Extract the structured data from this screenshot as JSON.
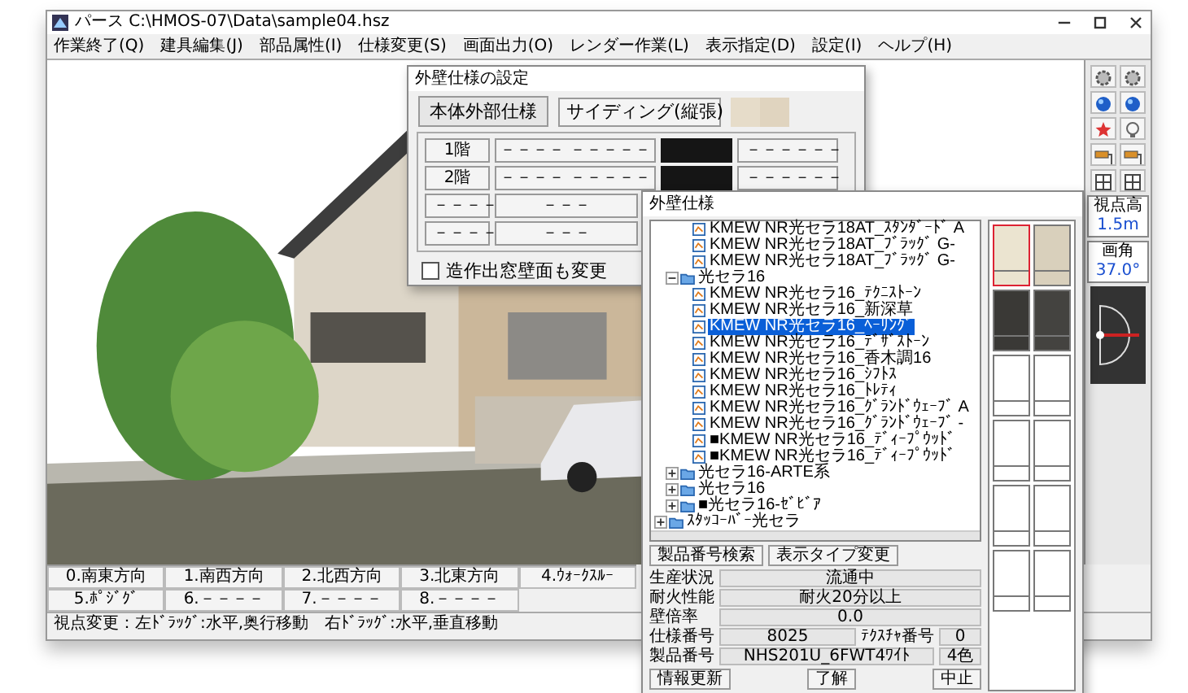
{
  "window": {
    "title": "パース C:\\HMOS-07\\Data\\sample04.hsz"
  },
  "menu": [
    "作業終了(Q)",
    "建具編集(J)",
    "部品属性(I)",
    "仕様変更(S)",
    "画面出力(O)",
    "レンダー作業(L)",
    "表示指定(D)",
    "設定(I)",
    "ヘルプ(H)"
  ],
  "side_panel": {
    "eye_height_label": "視点高",
    "eye_height": "1.5m",
    "angle_label": "画角",
    "angle": "37.0°"
  },
  "view_buttons": [
    "0.南東方向",
    "1.南西方向",
    "2.北西方向",
    "3.北東方向",
    "4.ｳｫｰｸｽﾙｰ",
    "5.ﾎﾟｼﾞｸﾞ",
    "6.－－－－",
    "7.－－－－",
    "8.－－－－"
  ],
  "status_bar": "視点変更：左ﾄﾞﾗｯｸﾞ:水平,奥行移動　右ﾄﾞﾗｯｸﾞ:水平,垂直移動",
  "wall_dialog": {
    "title": "外壁仕様の設定",
    "main_label": "本体外部仕様",
    "main_value": "サイディング(縦張)",
    "main_colors": [
      {
        "color": "#e6dcc9"
      },
      {
        "color": "#e0d4bf"
      }
    ],
    "floors": [
      {
        "label": "1階",
        "spec": "－－－－ －－－－－",
        "color": "#151515",
        "value": "－－－－－－"
      },
      {
        "label": "2階",
        "spec": "－－－－ －－－－－",
        "color": "#151515",
        "value": "－－－－－－"
      },
      {
        "label": "－－－－",
        "spec": "－－－"
      },
      {
        "label": "－－－－",
        "spec": "－－－"
      }
    ],
    "option": {
      "label": "造作出窓壁面も変更",
      "checked": false
    }
  },
  "spec_dialog": {
    "title": "外壁仕様",
    "tree": [
      {
        "kind": "continued",
        "children": [
          {
            "kind": "continued",
            "children": [
              {
                "kind": "item",
                "label": "KMEW NR光セラ18AT_ｽﾀﾝﾀﾞｰﾄﾞ A",
                "selected": false
              },
              {
                "kind": "item",
                "label": "KMEW NR光セラ18AT_ﾌﾞﾗｯｸﾞ G-",
                "selected": false
              },
              {
                "kind": "item",
                "label": "KMEW NR光セラ18AT_ﾌﾞﾗｯｸﾞ G-",
                "selected": false
              }
            ]
          },
          {
            "kind": "folder",
            "label": "光セラ16",
            "expanded": true,
            "children": [
              {
                "kind": "item",
                "label": "KMEW NR光セラ16_ﾃｸﾆｽﾄｰﾝ",
                "selected": false
              },
              {
                "kind": "item",
                "label": "KMEW NR光セラ16_新深草",
                "selected": false
              },
              {
                "kind": "item",
                "label": "KMEW NR光セラ16_ﾍｰﾘﾝｸﾞ",
                "selected": true
              },
              {
                "kind": "item",
                "label": "KMEW NR光セラ16_ﾃﾞｻﾞｽﾄｰﾝ",
                "selected": false
              },
              {
                "kind": "item",
                "label": "KMEW NR光セラ16_香木調16",
                "selected": false
              },
              {
                "kind": "item",
                "label": "KMEW NR光セラ16_ｼﾌﾄｽ",
                "selected": false
              },
              {
                "kind": "item",
                "label": "KMEW NR光セラ16_ﾄﾚﾃｨ",
                "selected": false
              },
              {
                "kind": "item",
                "label": "KMEW NR光セラ16_ｸﾞﾗﾝﾄﾞｳｪｰﾌﾞ A",
                "selected": false
              },
              {
                "kind": "item",
                "label": "KMEW NR光セラ16_ｸﾞﾗﾝﾄﾞｳｪｰﾌﾞ -",
                "selected": false
              },
              {
                "kind": "item",
                "label": "■KMEW NR光セラ16_ﾃﾞｨｰﾌﾟｳｯﾄﾞ",
                "selected": false
              },
              {
                "kind": "item",
                "label": "■KMEW NR光セラ16_ﾃﾞｨｰﾌﾟｳｯﾄﾞ",
                "selected": false
              }
            ]
          },
          {
            "kind": "folder",
            "label": "光セラ16-ARTE系",
            "expanded": false
          },
          {
            "kind": "folder",
            "label": "光セラ16",
            "expanded": false
          },
          {
            "kind": "folder",
            "label": "■光セラ16-ｾﾞﾋﾞｱ",
            "expanded": false
          }
        ]
      },
      {
        "kind": "folder",
        "label": "ｽﾀｯｺｰﾊﾞｰ光セラ",
        "expanded": false
      }
    ],
    "swatches": [
      {
        "kind": "texture",
        "color": "#ebe4d0",
        "selected": true
      },
      {
        "kind": "texture",
        "color": "#d9d0bc",
        "selected": false
      },
      {
        "kind": "texture",
        "color": "#3a3936",
        "selected": false
      },
      {
        "kind": "texture",
        "color": "#444340",
        "selected": false
      },
      {
        "kind": "empty",
        "selected": false
      },
      {
        "kind": "empty",
        "selected": false
      },
      {
        "kind": "empty",
        "selected": false
      },
      {
        "kind": "empty",
        "selected": false
      },
      {
        "kind": "empty",
        "selected": false
      },
      {
        "kind": "empty",
        "selected": false
      },
      {
        "kind": "empty",
        "selected": false
      },
      {
        "kind": "empty",
        "selected": false
      }
    ],
    "buttons": [
      "製品番号検索",
      "表示タイプ変更"
    ],
    "info": [
      {
        "label": "生産状況",
        "value": "流通中"
      },
      {
        "label": "耐火性能",
        "value": "耐火20分以上"
      },
      {
        "label": "壁倍率",
        "value": "0.0"
      },
      {
        "label": "仕様番号",
        "value": "8025",
        "label_2": "ﾃｸｽﾁｬ番号",
        "value_2": "0"
      },
      {
        "label": "製品番号",
        "value": "NHS201U_6FWT4ﾜｲﾄ",
        "value_2": "4色"
      }
    ],
    "footer_buttons": [
      "情報更新",
      "了解",
      "中止"
    ]
  }
}
